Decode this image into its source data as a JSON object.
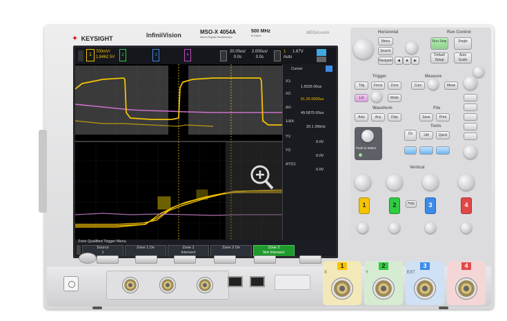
{
  "header": {
    "brand": "KEYSIGHT",
    "series": "InfiniiVision",
    "model": "MSO-X 4054A",
    "model_sub": "Mixed Signal Oscilloscope",
    "bandwidth": "500 MHz",
    "bandwidth_sub": "5 GSa/s",
    "mega_label": "MEGA",
    "mega_sub": "zoom"
  },
  "status_bar": {
    "ch1_scale": "700mV/",
    "ch1_offset": "1.8462 5V",
    "ch_nums": [
      "2",
      "3",
      "4"
    ],
    "h_scale": "20.00us/",
    "h_delay": "0.0s",
    "zoom_scale": "2.000us/",
    "zoom_delay": "0.0s",
    "trig_source": "1",
    "trig_level": "1.67V",
    "trig_mode": "Auto"
  },
  "side_panel": {
    "title": "Cursor",
    "x1_label": "X1:",
    "x1_value": "1.5025 00us",
    "x2_label": "X2:",
    "x2_value": "51.25 0000us",
    "dx_label": "ΔX:",
    "dx_value": "49.5875 00us",
    "inv_label": "1/ΔX:",
    "inv_value": "20.1 26kHz",
    "y1_label": "Y1:",
    "y1_value": "0.0V",
    "y2_label": "Y2:",
    "y2_value": "0.0V",
    "dy_label": "ΔY(1):",
    "dy_value": "0.0V"
  },
  "softkeys": {
    "menu_title": "Zone Qualified Trigger Menu",
    "items": [
      {
        "label": "Source",
        "value": "1"
      },
      {
        "label": "Zone 1 On",
        "value": ""
      },
      {
        "label": "Zone 1",
        "value": "Intersect"
      },
      {
        "label": "Zone 2 On",
        "value": ""
      },
      {
        "label": "Zone 2",
        "value": "Not Intersect"
      }
    ]
  },
  "front_panel": {
    "horizontal_label": "Horizontal",
    "run_control_label": "Run Control",
    "run_stop_label": "Run Stop",
    "single_label": "Single",
    "default_setup_label": "Default Setup",
    "auto_scale_label": "Auto Scale",
    "trigger_label": "Trigger",
    "measure_label": "Measure",
    "waveform_label": "Waveform",
    "file_label": "File",
    "tools_label": "Tools",
    "vertical_label": "Vertical",
    "help_label": "Help",
    "search_label": "Search",
    "navigate_label": "Navigate",
    "zoom_btn_label": "Zoom",
    "menu_label": "Menu",
    "push_label": "Push to Select"
  },
  "inputs": {
    "ch1_label": "1",
    "ch2_label": "2",
    "ch3_label": "3",
    "ch4_label": "4",
    "x_label": "X",
    "y_label": "Y",
    "ext_label": "EXT"
  },
  "colors": {
    "ch1": "#f5c400",
    "ch2": "#2ecc40",
    "ch3": "#3d8be8",
    "ch4": "#e04848",
    "brand": "#d01818"
  }
}
